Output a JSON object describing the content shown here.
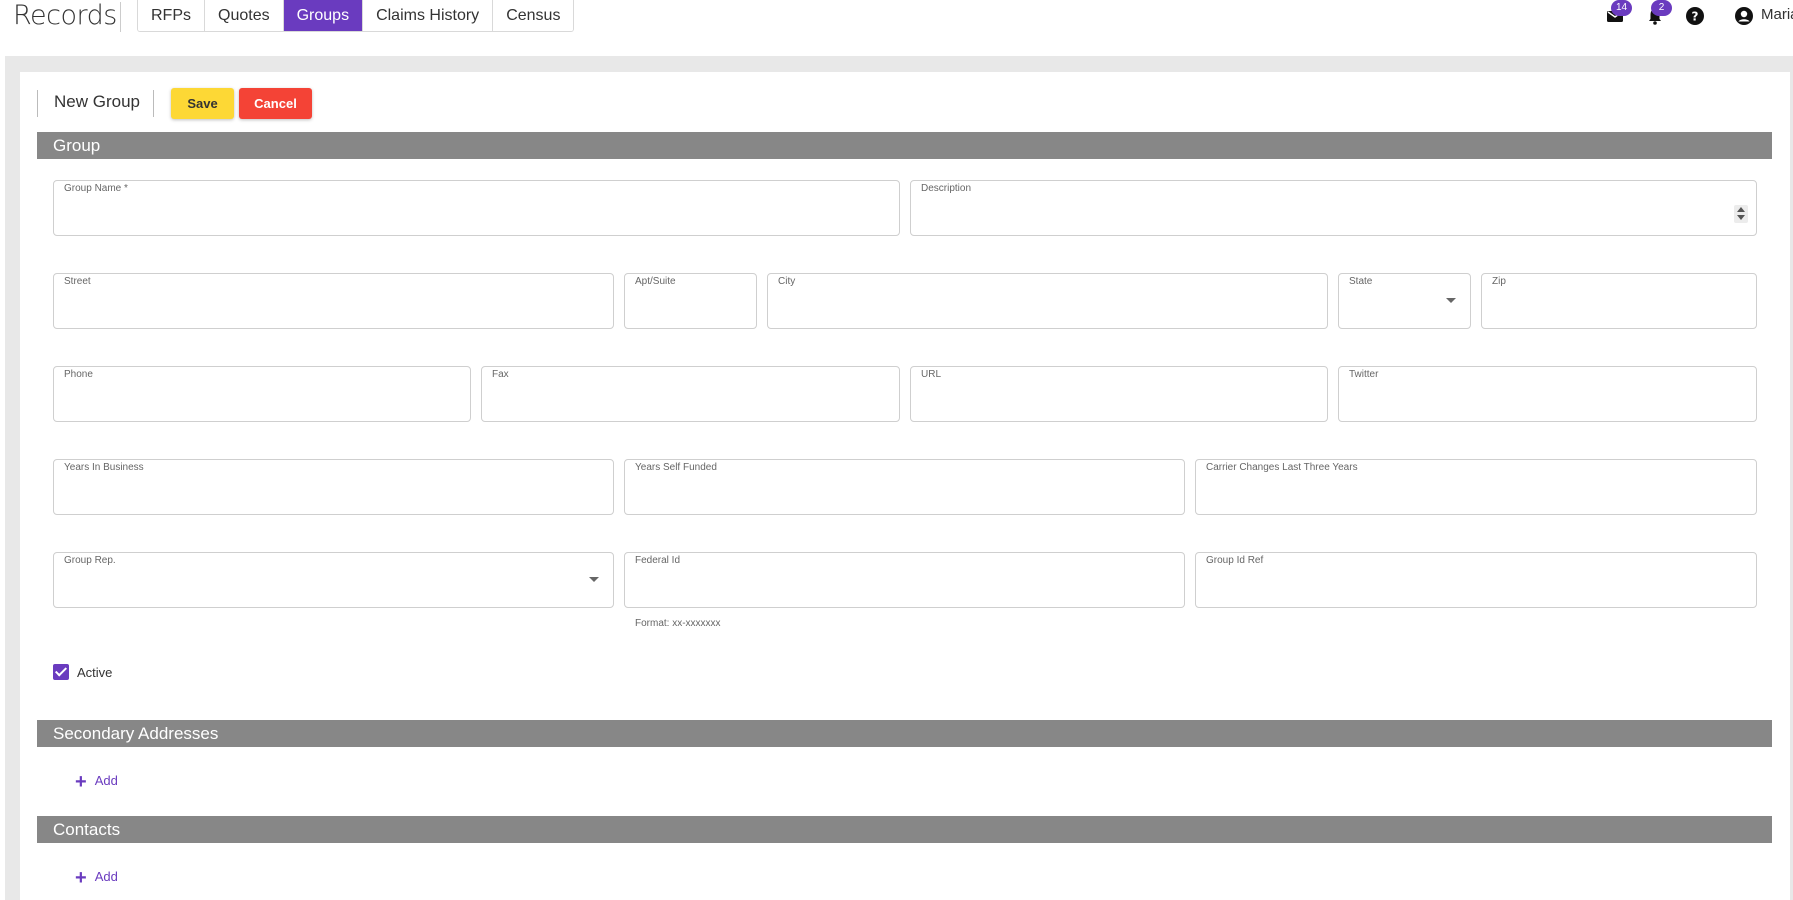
{
  "app": {
    "title": "Records"
  },
  "nav": {
    "tabs": [
      {
        "label": "RFPs",
        "active": false
      },
      {
        "label": "Quotes",
        "active": false
      },
      {
        "label": "Groups",
        "active": true
      },
      {
        "label": "Claims History",
        "active": false
      },
      {
        "label": "Census",
        "active": false
      }
    ]
  },
  "topbar": {
    "mail_count": "14",
    "notification_count": "2",
    "user_name": "Maria",
    "icons": [
      "mail-icon",
      "bell-icon",
      "help-icon",
      "user-icon"
    ]
  },
  "colors": {
    "accent": "#6a3bbf",
    "save": "#fdd835",
    "cancel": "#f44336",
    "section": "#878787"
  },
  "form": {
    "title": "New Group",
    "save_label": "Save",
    "cancel_label": "Cancel",
    "sections": {
      "group": "Group",
      "secondary_addresses": "Secondary Addresses",
      "contacts": "Contacts"
    },
    "fields": {
      "group_name": {
        "label": "Group Name *",
        "value": ""
      },
      "description": {
        "label": "Description",
        "value": ""
      },
      "street": {
        "label": "Street",
        "value": ""
      },
      "apt_suite": {
        "label": "Apt/Suite",
        "value": ""
      },
      "city": {
        "label": "City",
        "value": ""
      },
      "state": {
        "label": "State",
        "value": ""
      },
      "zip": {
        "label": "Zip",
        "value": ""
      },
      "phone": {
        "label": "Phone",
        "value": ""
      },
      "fax": {
        "label": "Fax",
        "value": ""
      },
      "url": {
        "label": "URL",
        "value": ""
      },
      "twitter": {
        "label": "Twitter",
        "value": ""
      },
      "years_in_business": {
        "label": "Years In Business",
        "value": ""
      },
      "years_self_funded": {
        "label": "Years Self Funded",
        "value": ""
      },
      "carrier_changes": {
        "label": "Carrier Changes Last Three Years",
        "value": ""
      },
      "group_rep": {
        "label": "Group Rep.",
        "value": ""
      },
      "federal_id": {
        "label": "Federal Id",
        "value": "",
        "hint": "Format: xx-xxxxxxx"
      },
      "group_id_ref": {
        "label": "Group Id Ref",
        "value": ""
      }
    },
    "active": {
      "label": "Active",
      "checked": true
    },
    "add_label": "Add"
  }
}
